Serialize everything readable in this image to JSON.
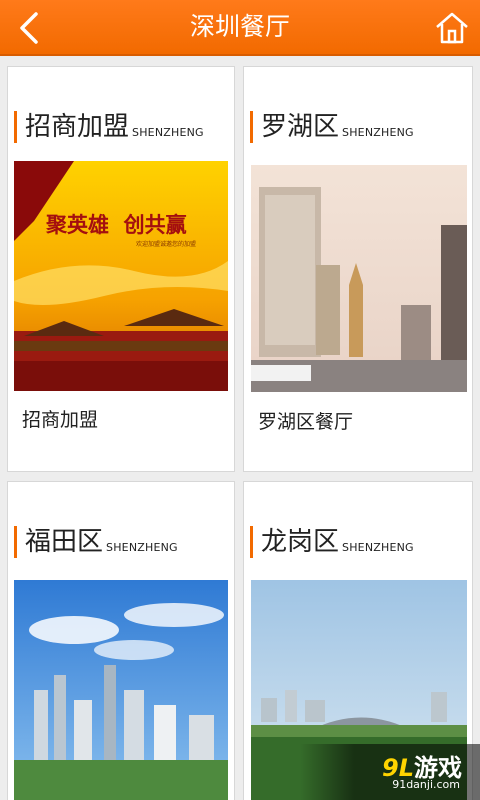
{
  "header": {
    "title": "深圳餐厅",
    "back_icon": "chevron-left-icon",
    "home_icon": "home-icon"
  },
  "cards": [
    {
      "name": "招商加盟",
      "en": "SHENZHENG",
      "caption": "招商加盟",
      "poster_title": "聚英雄  创共赢",
      "poster_sub": "欢迎加盟诚邀您的加盟"
    },
    {
      "name": "罗湖区",
      "en": "SHENZHENG",
      "caption": "罗湖区餐厅"
    },
    {
      "name": "福田区",
      "en": "SHENZHENG",
      "caption": ""
    },
    {
      "name": "龙岗区",
      "en": "SHENZHENG",
      "caption": ""
    }
  ],
  "watermark": {
    "logo_num": "9L",
    "logo_text": "游戏",
    "site": "91danji.com"
  },
  "colors": {
    "accent": "#f26a00",
    "background": "#ededed"
  }
}
